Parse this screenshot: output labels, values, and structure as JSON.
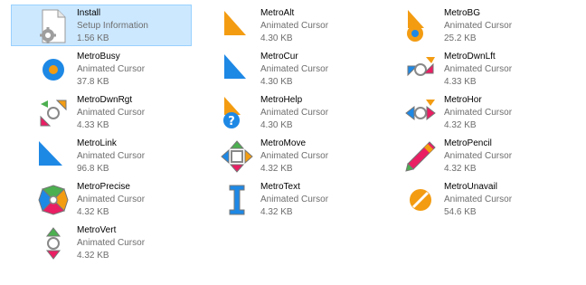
{
  "files": [
    {
      "name": "Install",
      "type": "Setup Information",
      "size": "1.56 KB",
      "icon": "setup-info-file-icon",
      "selected": true
    },
    {
      "name": "MetroAlt",
      "type": "Animated Cursor",
      "size": "4.30 KB",
      "icon": "arrow-cursor-icon",
      "color": "#f39c12"
    },
    {
      "name": "MetroBG",
      "type": "Animated Cursor",
      "size": "25.2 KB",
      "icon": "background-busy-cursor-icon",
      "color": "#f39c12"
    },
    {
      "name": "MetroBusy",
      "type": "Animated Cursor",
      "size": "37.8 KB",
      "icon": "busy-cursor-icon",
      "color": "#1e88e5"
    },
    {
      "name": "MetroCur",
      "type": "Animated Cursor",
      "size": "4.30 KB",
      "icon": "arrow-cursor-icon",
      "color": "#1e88e5"
    },
    {
      "name": "MetroDwnLft",
      "type": "Animated Cursor",
      "size": "4.33 KB",
      "icon": "diagonal-resize-left-cursor-icon"
    },
    {
      "name": "MetroDwnRgt",
      "type": "Animated Cursor",
      "size": "4.33 KB",
      "icon": "diagonal-resize-right-cursor-icon"
    },
    {
      "name": "MetroHelp",
      "type": "Animated Cursor",
      "size": "4.30 KB",
      "icon": "help-cursor-icon",
      "color": "#f39c12"
    },
    {
      "name": "MetroHor",
      "type": "Animated Cursor",
      "size": "4.32 KB",
      "icon": "horizontal-resize-cursor-icon"
    },
    {
      "name": "MetroLink",
      "type": "Animated Cursor",
      "size": "96.8 KB",
      "icon": "link-cursor-icon",
      "color": "#1e88e5"
    },
    {
      "name": "MetroMove",
      "type": "Animated Cursor",
      "size": "4.32 KB",
      "icon": "move-cursor-icon"
    },
    {
      "name": "MetroPencil",
      "type": "Animated Cursor",
      "size": "4.32 KB",
      "icon": "pencil-cursor-icon"
    },
    {
      "name": "MetroPrecise",
      "type": "Animated Cursor",
      "size": "4.32 KB",
      "icon": "precise-cursor-icon"
    },
    {
      "name": "MetroText",
      "type": "Animated Cursor",
      "size": "4.32 KB",
      "icon": "text-cursor-icon",
      "color": "#1e88e5"
    },
    {
      "name": "MetroUnavail",
      "type": "Animated Cursor",
      "size": "54.6 KB",
      "icon": "unavailable-cursor-icon",
      "color": "#f39c12"
    },
    {
      "name": "MetroVert",
      "type": "Animated Cursor",
      "size": "4.32 KB",
      "icon": "vertical-resize-cursor-icon"
    }
  ]
}
